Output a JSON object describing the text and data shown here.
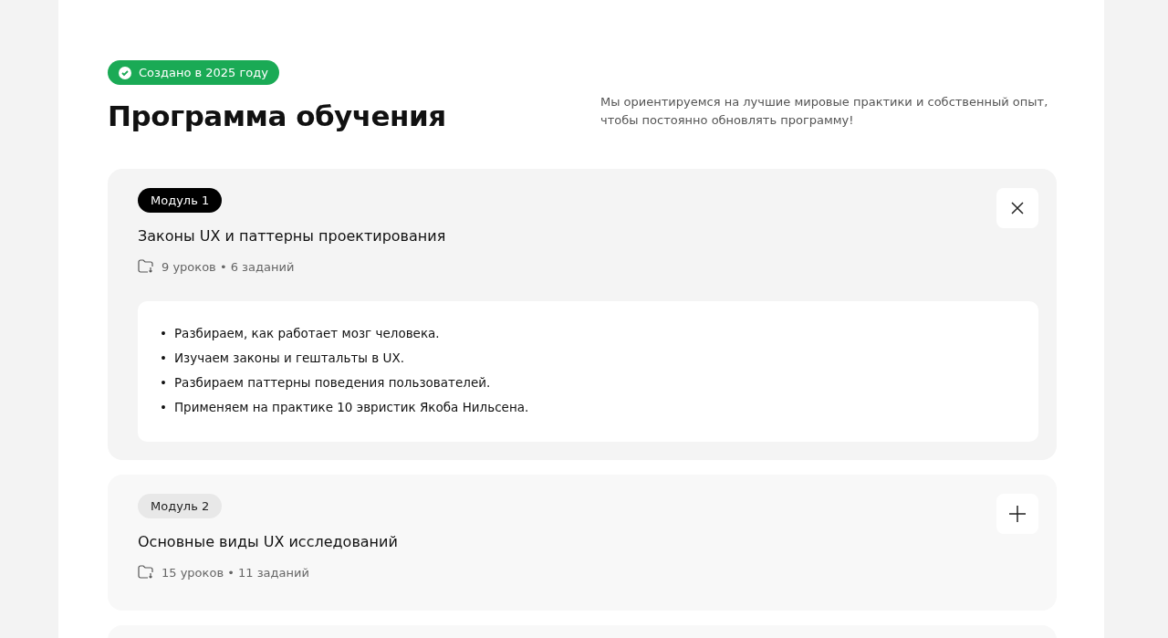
{
  "badge": {
    "label": "Создано в 2025 году"
  },
  "title": "Программа обучения",
  "description": "Мы ориентируемся на лучшие мировые практики и собственный опыт, чтобы постоянно обновлять программу!",
  "modules": [
    {
      "tag": "Модуль 1",
      "title": "Законы UX и паттерны проектирования",
      "meta": "9 уроков • 6 заданий",
      "expanded": true,
      "marker": "•",
      "topics": [
        "Разбираем, как работает мозг человека.",
        "Изучаем законы и гештальты в UX.",
        "Разбираем паттерны поведения пользователей.",
        "Применяем на практике 10 эвристик Якоба Нильсена."
      ]
    },
    {
      "tag": "Модуль 2",
      "title": "Основные виды UX исследований",
      "meta": "15 уроков • 11 заданий",
      "expanded": false
    }
  ]
}
